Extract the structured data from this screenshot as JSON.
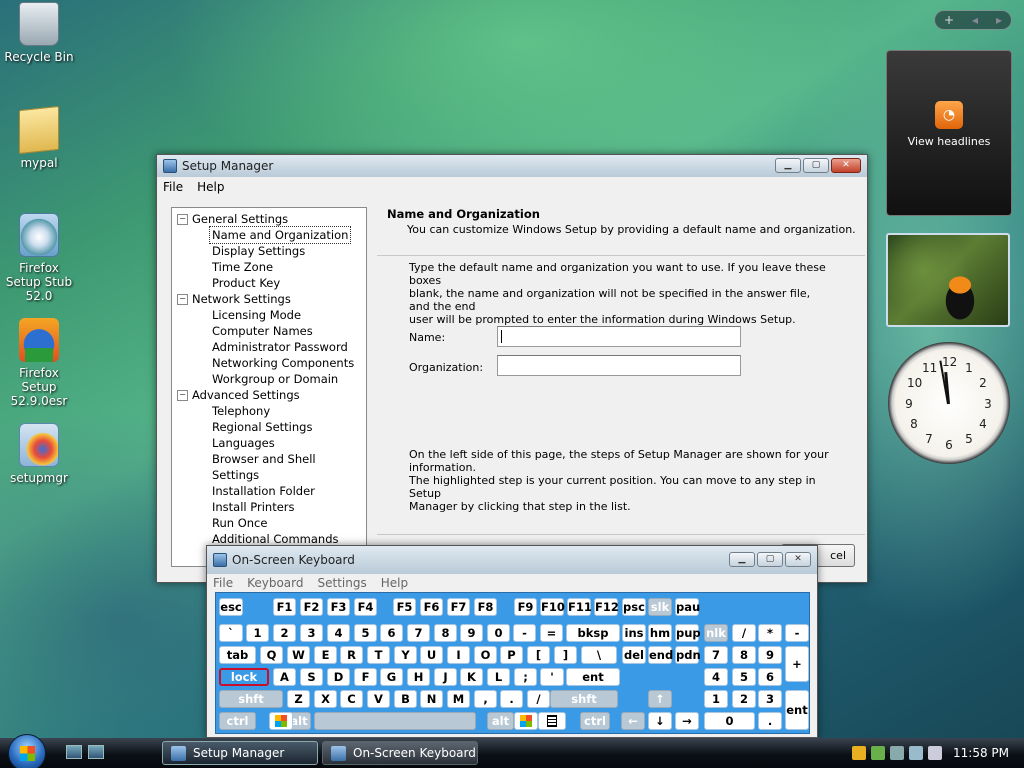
{
  "desktop": {
    "icons": [
      {
        "label": "Recycle Bin"
      },
      {
        "label": "mypal"
      },
      {
        "label": "Firefox Setup Stub 52.0"
      },
      {
        "label": "Firefox Setup 52.9.0esr"
      },
      {
        "label": "setupmgr"
      }
    ],
    "feed_gadget": {
      "label": "View headlines"
    }
  },
  "setup_manager": {
    "title": "Setup Manager",
    "menu": [
      "File",
      "Help"
    ],
    "tree": [
      {
        "label": "General Settings",
        "children": [
          "Name and Organization",
          "Display Settings",
          "Time Zone",
          "Product Key"
        ]
      },
      {
        "label": "Network Settings",
        "children": [
          "Licensing Mode",
          "Computer Names",
          "Administrator Password",
          "Networking Components",
          "Workgroup or Domain"
        ]
      },
      {
        "label": "Advanced Settings",
        "children": [
          "Telephony",
          "Regional Settings",
          "Languages",
          "Browser and Shell Settings",
          "Installation Folder",
          "Install Printers",
          "Run Once",
          "Additional Commands"
        ]
      }
    ],
    "selected": "Name and Organization",
    "page_title": "Name and Organization",
    "page_subtitle": "You can customize Windows Setup by providing a default name and organization.",
    "instructions_1": "Type the default name and organization you want to use. If you leave these boxes",
    "instructions_2": "blank, the name and organization will not be specified in the answer file, and the end",
    "instructions_3": "user will be prompted to enter the information during Windows Setup.",
    "name_label": "Name:",
    "name_value": "",
    "org_label": "Organization:",
    "org_value": "",
    "footer_1": "On the left side of this page, the steps of Setup Manager are shown for your information.",
    "footer_2": "The highlighted step is your current position. You can move to any step in Setup",
    "footer_3": "Manager by clicking that step in the list.",
    "cancel_fragment": "cel"
  },
  "osk": {
    "title": "On-Screen Keyboard",
    "menu": [
      "File",
      "Keyboard",
      "Settings",
      "Help"
    ],
    "rows": {
      "r1": [
        "esc",
        "F1",
        "F2",
        "F3",
        "F4",
        "F5",
        "F6",
        "F7",
        "F8",
        "F9",
        "F10",
        "F11",
        "F12",
        "psc",
        "slk",
        "pau"
      ],
      "r2": [
        "`",
        "1",
        "2",
        "3",
        "4",
        "5",
        "6",
        "7",
        "8",
        "9",
        "0",
        "-",
        "=",
        "bksp",
        "ins",
        "hm",
        "pup",
        "nlk",
        "/",
        "*",
        "-"
      ],
      "r3": [
        "tab",
        "Q",
        "W",
        "E",
        "R",
        "T",
        "Y",
        "U",
        "I",
        "O",
        "P",
        "[",
        "]",
        "\\",
        "del",
        "end",
        "pdn",
        "7",
        "8",
        "9",
        "+"
      ],
      "r4": [
        "lock",
        "A",
        "S",
        "D",
        "F",
        "G",
        "H",
        "J",
        "K",
        "L",
        ";",
        "'",
        "ent",
        "4",
        "5",
        "6"
      ],
      "r5": [
        "shft",
        "Z",
        "X",
        "C",
        "V",
        "B",
        "N",
        "M",
        ",",
        ".",
        "/",
        "shft",
        "↑",
        "1",
        "2",
        "3",
        "ent"
      ],
      "r6": [
        "ctrl",
        "alt",
        "alt",
        "ctrl",
        "←",
        "↓",
        "→",
        "0",
        "."
      ]
    }
  },
  "taskbar": {
    "buttons": [
      "Setup Manager",
      "On-Screen Keyboard"
    ],
    "time": "11:58 PM"
  }
}
